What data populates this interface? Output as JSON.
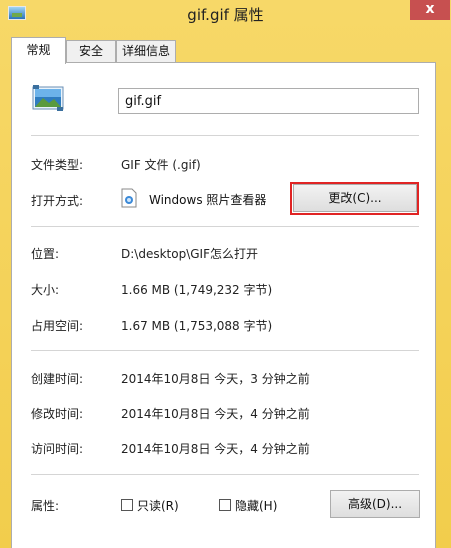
{
  "window": {
    "title": "gif.gif 属性",
    "close_glyph": "x"
  },
  "tabs": [
    {
      "label": "常规",
      "active": true
    },
    {
      "label": "安全",
      "active": false
    },
    {
      "label": "详细信息",
      "active": false
    }
  ],
  "file": {
    "name": "gif.gif",
    "icon": "image-file-icon"
  },
  "type_section": {
    "file_type_label": "文件类型:",
    "file_type_value": "GIF 文件 (.gif)",
    "opens_with_label": "打开方式:",
    "opens_with_app": "Windows 照片查看器",
    "opens_with_icon": "photo-viewer-icon",
    "change_button": "更改(C)..."
  },
  "location_section": {
    "location_label": "位置:",
    "location_value": "D:\\desktop\\GIF怎么打开",
    "size_label": "大小:",
    "size_value": "1.66 MB (1,749,232 字节)",
    "size_on_disk_label": "占用空间:",
    "size_on_disk_value": "1.67 MB (1,753,088 字节)"
  },
  "dates_section": {
    "created_label": "创建时间:",
    "created_value": "2014年10月8日 今天，3 分钟之前",
    "modified_label": "修改时间:",
    "modified_value": "2014年10月8日 今天，4 分钟之前",
    "accessed_label": "访问时间:",
    "accessed_value": "2014年10月8日 今天，4 分钟之前"
  },
  "attributes": {
    "label": "属性:",
    "readonly_label": "只读(R)",
    "readonly_checked": false,
    "hidden_label": "隐藏(H)",
    "hidden_checked": false,
    "advanced_button": "高级(D)..."
  },
  "colors": {
    "frame": "#f2cd4c",
    "close_button": "#c75050",
    "highlight_border": "#e02424"
  }
}
